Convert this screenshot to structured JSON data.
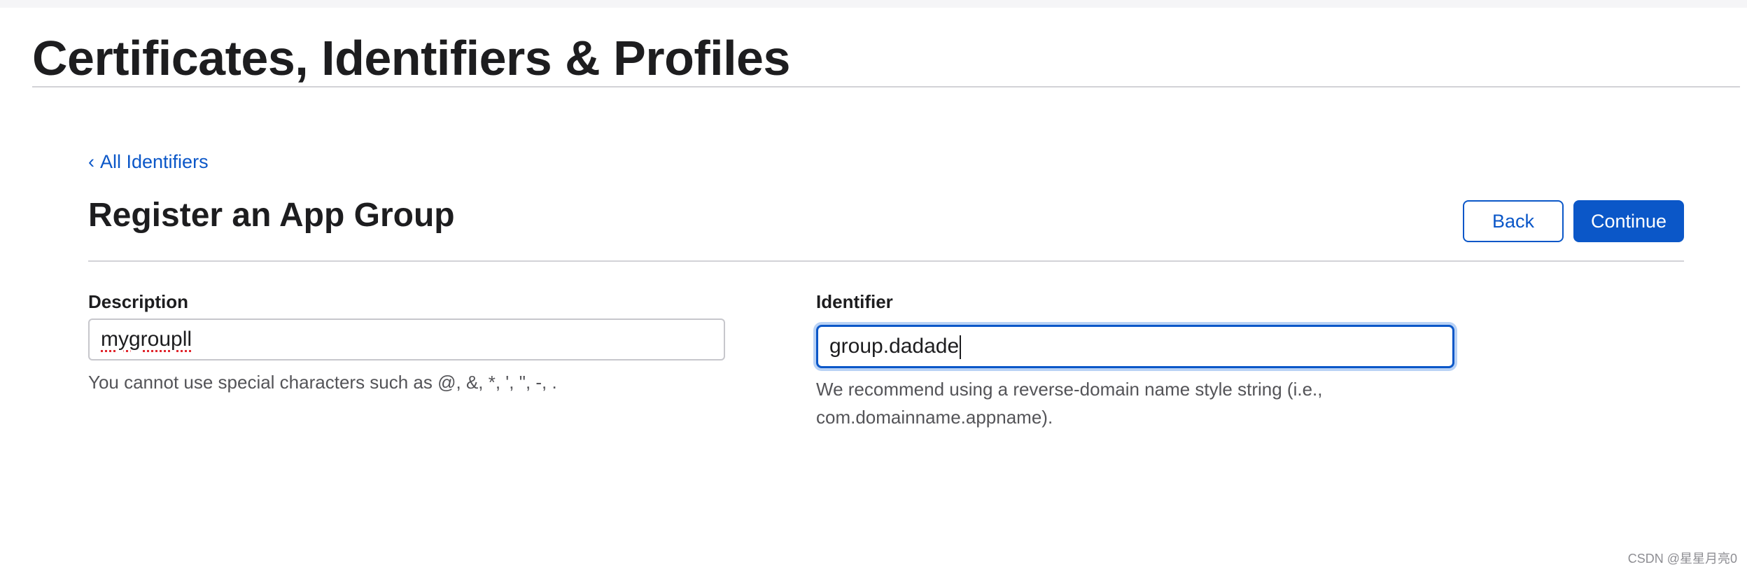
{
  "page": {
    "title": "Certificates, Identifiers & Profiles"
  },
  "nav": {
    "back_link_chevron": "‹",
    "back_link_label": "All Identifiers"
  },
  "section": {
    "title": "Register an App Group"
  },
  "actions": {
    "back_label": "Back",
    "continue_label": "Continue"
  },
  "form": {
    "description": {
      "label": "Description",
      "value": "mygroupll",
      "help": "You cannot use special characters such as @, &, *, ', \", -, ."
    },
    "identifier": {
      "label": "Identifier",
      "value": "group.dadade",
      "help": "We recommend using a reverse-domain name style string (i.e., com.domainname.appname).",
      "focused": true
    }
  },
  "watermark": "CSDN @星星月亮0",
  "colors": {
    "accent": "#0b57c8",
    "focus_ring": "#b9d2f5",
    "rule": "#d2d2d7",
    "text": "#1d1d1f",
    "muted_text": "#545458"
  }
}
